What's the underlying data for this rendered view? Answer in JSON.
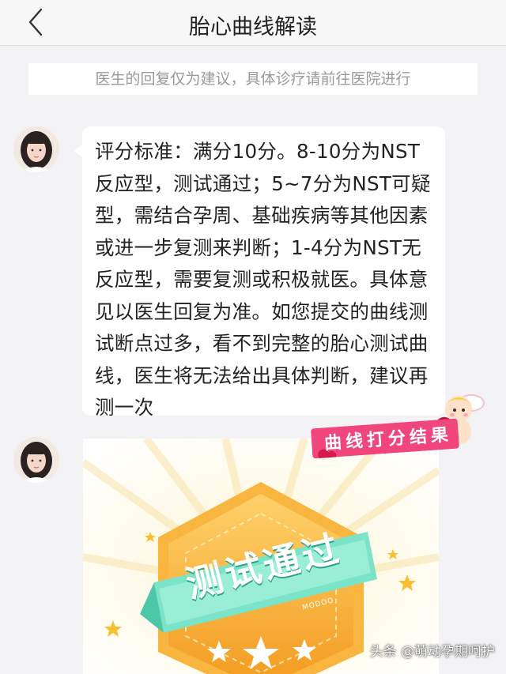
{
  "header": {
    "title": "胎心曲线解读"
  },
  "notice": {
    "text": "医生的回复仅为建议，具体诊疗请前往医院进行"
  },
  "messages": [
    {
      "text": "评分标准：满分10分。8-10分为NST反应型，测试通过；5~7分为NST可疑型，需结合孕周、基础疾病等其他因素或进一步复测来判断；1-4分为NST无反应型，需要复测或积极就医。具体意见以医生回复为准。如您提交的曲线测试断点过多，看不到完整的胎心测试曲线，医生将无法给出具体判断，建议再测一次"
    },
    {
      "badge_text": "测试通过",
      "badge_sub": "MODOO"
    }
  ],
  "sticker": {
    "text": "曲线打分结果"
  },
  "watermark": {
    "text": "头条 @萌动孕期呵护"
  },
  "colors": {
    "badge_orange": "#f5a623",
    "badge_ribbon": "#6fdcc0",
    "sticker_pink": "#f0457d"
  }
}
